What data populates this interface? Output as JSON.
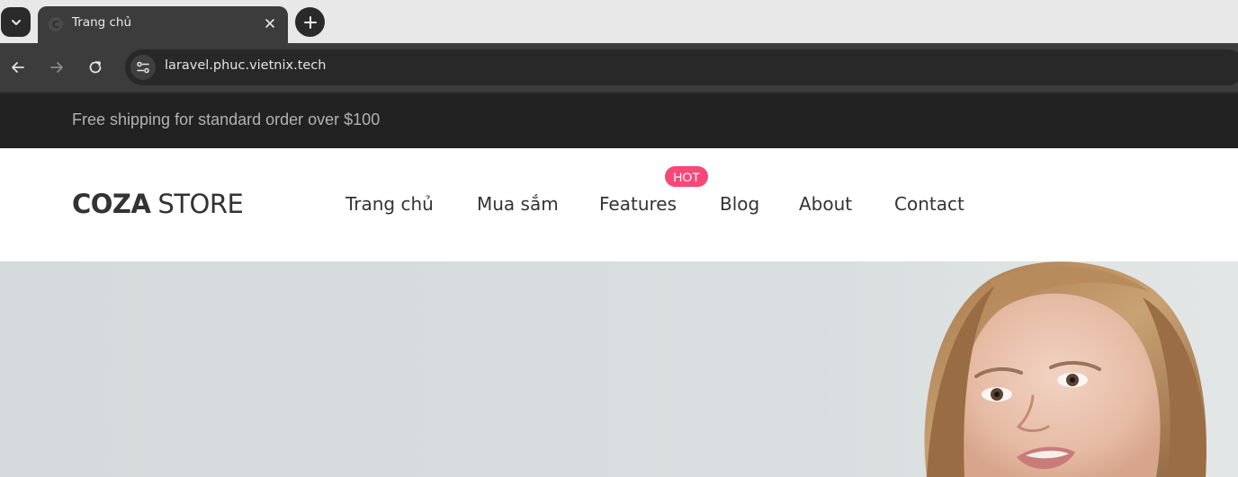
{
  "browser": {
    "tab_title": "Trang chủ",
    "url": "laravel.phuc.vietnix.tech"
  },
  "topbar": {
    "text": "Free shipping for standard order over $100"
  },
  "header": {
    "logo_bold": "COZA",
    "logo_light": "STORE",
    "menu": [
      {
        "label": "Trang chủ"
      },
      {
        "label": "Mua sắm"
      },
      {
        "label": "Features"
      },
      {
        "label": "Blog"
      },
      {
        "label": "About"
      },
      {
        "label": "Contact"
      }
    ],
    "hot_badge": "HOT"
  },
  "colors": {
    "topbar_bg": "#222222",
    "hot_badge": "#f74877",
    "hero_bg": "#d6dcdd"
  },
  "icons": [
    "chevron-down-icon",
    "close-icon",
    "plus-icon",
    "arrow-left-icon",
    "arrow-right-icon",
    "reload-icon",
    "site-settings-icon"
  ]
}
